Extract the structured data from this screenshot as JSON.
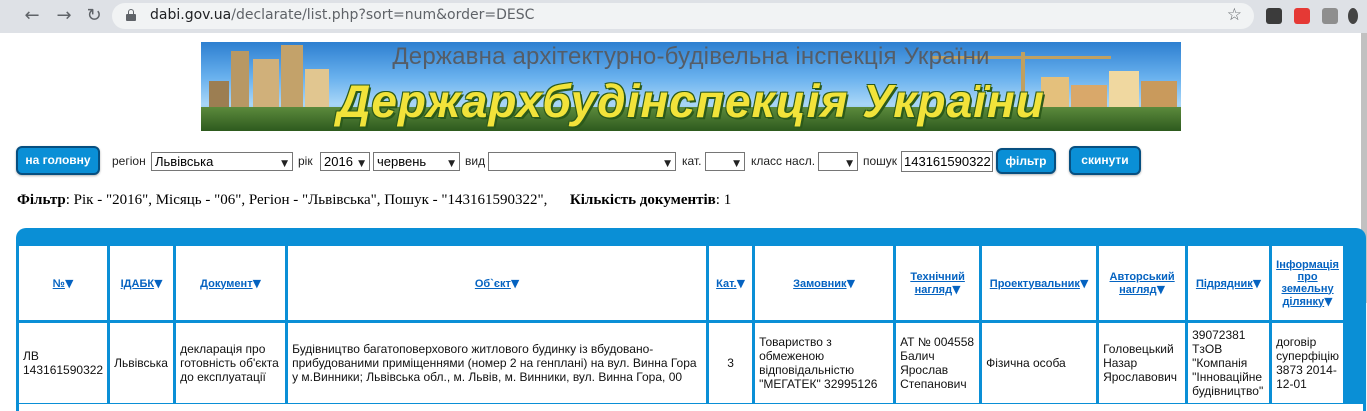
{
  "browser": {
    "url_host": "dabi.gov.ua",
    "url_path": "/declarate/list.php?sort=num&order=DESC"
  },
  "banner": {
    "subtitle": "Державна архітектурно-будівельна інспекція України",
    "title": "Держархбудінспекція України"
  },
  "filters": {
    "home_button": "на головну",
    "region_label": "регіон",
    "region_value": "Львівська",
    "year_label": "рік",
    "year_value": "2016",
    "month_value": "червень",
    "type_label": "вид",
    "type_value": "",
    "cat_label": "кат.",
    "cat_value": "",
    "class_label": "класс насл.",
    "class_value": "",
    "search_label": "пошук",
    "search_value": "143161590322",
    "filter_button": "фільтр",
    "reset_button": "скинути"
  },
  "summary": {
    "filter_label": "Фільтр",
    "filter_text": ": Рік - \"2016\", Місяць - \"06\", Регіон - \"Львівська\", Пошук - \"143161590322\",",
    "count_label": "Кількість документів",
    "count_value": ": 1"
  },
  "table": {
    "headers": [
      "№",
      "ІДАБК",
      "Документ",
      "Об`єкт",
      "Кат.",
      "Замовник",
      "Технічний нагляд",
      "Проектувальник",
      "Авторський нагляд",
      "Підрядник",
      "Інформація про земельну ділянку"
    ],
    "row": {
      "num": "ЛВ 143161590322",
      "idabk": "Львівська",
      "document": "декларація про готовність об'єкта до експлуатації",
      "object": "Будівництво багатоповерхового житлового будинку із вбудовано-прибудованими приміщеннями (номер 2 на генплані) на вул. Винна Гора у м.Винники; Львівська обл., м. Львів, м. Винники, вул. Винна Гора, 00",
      "cat": "3",
      "customer": "Товариство з обмеженою відповідальністю \"МЕГАТЕК\" 32995126",
      "tech_supervision": "АТ № 004558 Балич Ярослав Степанович",
      "designer": "Фізична особа",
      "author_supervision": "Головецький Назар Ярославович",
      "contractor": "39072381 ТзОВ \"Компанія \"Інноваційне будівництво\"",
      "land_info": "договір суперфіцію 3873 2014-12-01"
    }
  },
  "colors": {
    "accent": "#0a8fd6",
    "link": "#0563c1"
  }
}
